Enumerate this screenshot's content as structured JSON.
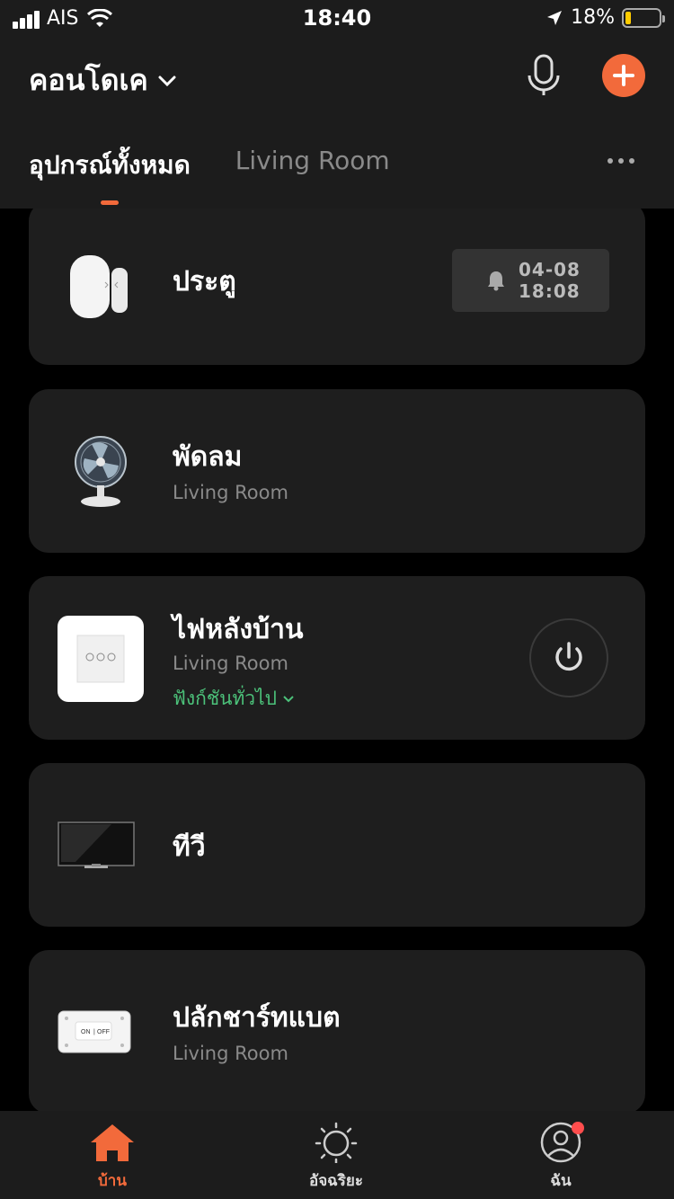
{
  "status_bar": {
    "carrier": "AIS",
    "time": "18:40",
    "battery": "18%",
    "battery_level": 0.18
  },
  "header": {
    "home_name": "คอนโดเค",
    "tabs": [
      {
        "label": "อุปกรณ์ทั้งหมด",
        "active": true
      },
      {
        "label": "Living Room",
        "active": false
      }
    ]
  },
  "devices": [
    {
      "name": "ประตู",
      "room": "",
      "notification": {
        "date": "04-08",
        "time": "18:08"
      },
      "icon": "door-sensor-icon"
    },
    {
      "name": "พัดลม",
      "room": "Living Room",
      "icon": "fan-icon"
    },
    {
      "name": "ไฟหลังบ้าน",
      "room": "Living Room",
      "function": "ฟังก์ชันทั่วไป",
      "icon": "wall-switch-icon",
      "power": true
    },
    {
      "name": "ทีวี",
      "room": "",
      "icon": "tv-icon"
    },
    {
      "name": "ปลักชาร์ทแบต",
      "room": "Living Room",
      "icon": "smart-plug-icon",
      "plug_labels": {
        "on": "ON",
        "off": "OFF"
      }
    }
  ],
  "bottom_nav": [
    {
      "label": "บ้าน",
      "icon": "home-icon",
      "active": true
    },
    {
      "label": "อัจฉริยะ",
      "icon": "sun-icon",
      "active": false
    },
    {
      "label": "ฉัน",
      "icon": "profile-icon",
      "active": false,
      "badge": true
    }
  ],
  "colors": {
    "accent": "#f26a3b",
    "function_link": "#4cc27a",
    "card_bg": "#1e1e1e",
    "badge": "#ff4d4d"
  }
}
